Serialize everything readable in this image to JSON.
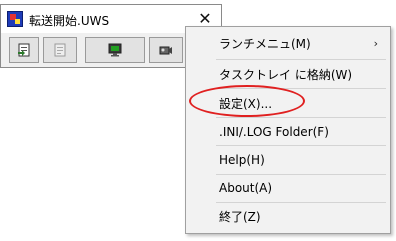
{
  "window": {
    "title": "転送開始.UWS",
    "close_glyph": "✕",
    "toolbar": [
      {
        "icon": "transfer-document-icon"
      },
      {
        "icon": "disabled-document-icon"
      },
      {
        "icon": "monitor-icon"
      },
      {
        "icon": "camera-icon"
      }
    ]
  },
  "context_menu": {
    "items": [
      {
        "label": "ランチメニュ(M)",
        "submenu_glyph": "›"
      },
      {
        "label": "タスクトレイ に格納(W)"
      },
      {
        "label": "設定(X)..."
      },
      {
        "label": ".INI/.LOG Folder(F)"
      },
      {
        "label": "Help(H)"
      },
      {
        "label": "About(A)"
      },
      {
        "label": "終了(Z)"
      }
    ]
  },
  "colors": {
    "annotation": "#e02020",
    "menu_bg": "#f2f2f2"
  }
}
